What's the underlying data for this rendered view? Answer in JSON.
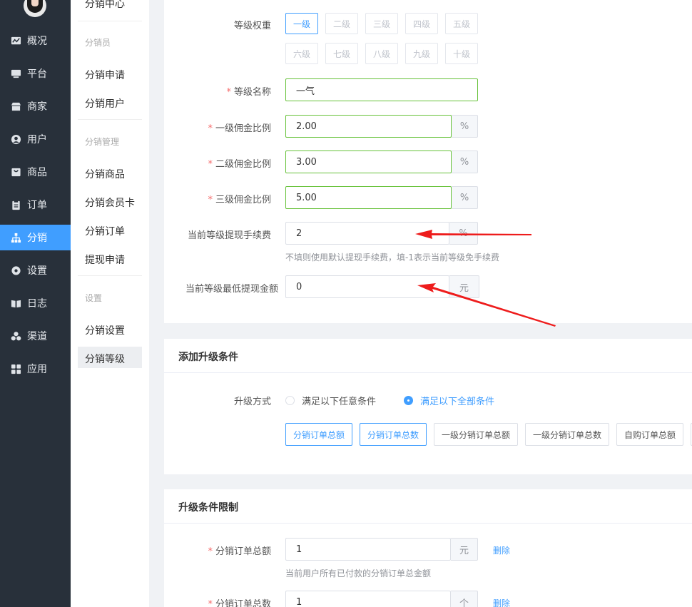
{
  "sidebar": {
    "items": [
      {
        "label": "概况",
        "icon": "chart-line-icon"
      },
      {
        "label": "平台",
        "icon": "monitor-icon"
      },
      {
        "label": "商家",
        "icon": "store-icon"
      },
      {
        "label": "用户",
        "icon": "user-icon"
      },
      {
        "label": "商品",
        "icon": "shopping-bag-icon"
      },
      {
        "label": "订单",
        "icon": "clipboard-icon"
      },
      {
        "label": "分销",
        "icon": "sitemap-icon",
        "active": true
      },
      {
        "label": "设置",
        "icon": "gear-icon"
      },
      {
        "label": "日志",
        "icon": "book-icon"
      },
      {
        "label": "渠道",
        "icon": "channel-circles-icon"
      },
      {
        "label": "应用",
        "icon": "apps-grid-icon"
      }
    ]
  },
  "submenu": {
    "top": "分销中心",
    "group1": "分销员",
    "apply": "分销申请",
    "users": "分销用户",
    "group2": "分销管理",
    "goods": "分销商品",
    "card": "分销会员卡",
    "orders": "分销订单",
    "withdraw": "提现申请",
    "group3": "设置",
    "settings": "分销设置",
    "levels": "分销等级"
  },
  "form": {
    "weight_label": "等级权重",
    "weights": [
      "一级",
      "二级",
      "三级",
      "四级",
      "五级",
      "六级",
      "七级",
      "八级",
      "九级",
      "十级"
    ],
    "selected_weight": "一级",
    "name_label": "等级名称",
    "name_value": "一气",
    "c1_label": "一级佣金比例",
    "c1_value": "2.00",
    "c2_label": "二级佣金比例",
    "c2_value": "3.00",
    "c3_label": "三级佣金比例",
    "c3_value": "5.00",
    "percent": "%",
    "fee_label": "当前等级提现手续费",
    "fee_value": "2",
    "fee_hint": "不填则使用默认提现手续费，填-1表示当前等级免手续费",
    "min_label": "当前等级最低提现金额",
    "min_value": "0",
    "yuan": "元"
  },
  "upgrade": {
    "title": "添加升级条件",
    "mode_label": "升级方式",
    "option_any": "满足以下任意条件",
    "option_all": "满足以下全部条件",
    "conditions": [
      "分销订单总额",
      "分销订单总数",
      "一级分销订单总额",
      "一级分销订单总数",
      "自购订单总额"
    ]
  },
  "limits": {
    "title": "升级条件限制",
    "total_amount_label": "分销订单总额",
    "total_amount_value": "1",
    "total_amount_unit": "元",
    "total_amount_hint": "当前用户所有已付款的分销订单总金额",
    "total_count_label": "分销订单总数",
    "total_count_value": "1",
    "total_count_unit": "个",
    "delete": "删除"
  }
}
